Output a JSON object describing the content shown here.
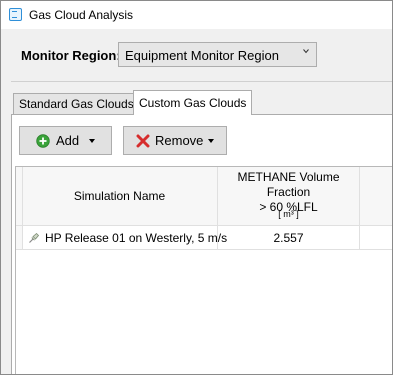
{
  "window": {
    "title": "Gas Cloud Analysis",
    "icon": "app-window-icon"
  },
  "monitor_region": {
    "label": "Monitor Region:",
    "selected": "Equipment Monitor Region"
  },
  "tabs": [
    {
      "label": "Standard Gas Clouds",
      "active": false
    },
    {
      "label": "Custom Gas Clouds",
      "active": true
    }
  ],
  "toolbar": {
    "add_label": "Add",
    "remove_label": "Remove",
    "add_icon": "green-plus-circle-icon",
    "remove_icon": "red-x-icon"
  },
  "grid": {
    "columns": [
      {
        "header": "Simulation Name"
      },
      {
        "header_line1": "METHANE Volume Fraction",
        "header_line2": "> 60 %LFL",
        "unit": "[ m³ ]"
      }
    ],
    "rows": [
      {
        "simulation": "HP Release 01 on Westerly, 5 m/s",
        "value": "2.557",
        "icon": "pin-icon"
      }
    ]
  },
  "colors": {
    "accent_blue": "#2f8fd8",
    "add_green": "#3aa33a",
    "remove_red": "#d62d2d"
  }
}
